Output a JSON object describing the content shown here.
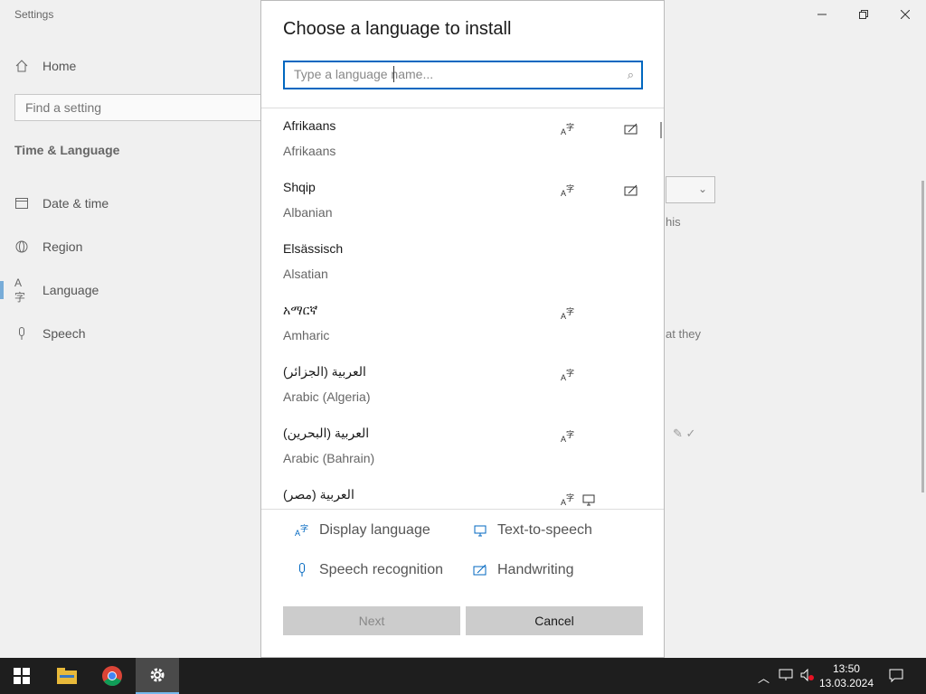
{
  "window": {
    "title": "Settings",
    "minimize_icon": "minimize-icon",
    "restore_icon": "restore-icon",
    "close_icon": "close-icon"
  },
  "sidebar": {
    "home": "Home",
    "find_placeholder": "Find a setting",
    "section": "Time & Language",
    "items": [
      {
        "label": "Date & time",
        "icon": "clock-calendar-icon"
      },
      {
        "label": "Region",
        "icon": "globe-icon"
      },
      {
        "label": "Language",
        "icon": "language-icon",
        "active": true
      },
      {
        "label": "Speech",
        "icon": "microphone-icon"
      }
    ]
  },
  "background_fragments": {
    "frag1": "his",
    "frag2": "at they"
  },
  "dialog": {
    "title": "Choose a language to install",
    "search_placeholder": "Type a language name...",
    "languages": [
      {
        "native": "Afrikaans",
        "english": "Afrikaans",
        "display": true,
        "handwriting": true
      },
      {
        "native": "Shqip",
        "english": "Albanian",
        "display": true,
        "handwriting": true
      },
      {
        "native": "Elsässisch",
        "english": "Alsatian"
      },
      {
        "native": "አማርኛ",
        "english": "Amharic",
        "display": true
      },
      {
        "native": "العربية (الجزائر)",
        "english": "Arabic (Algeria)",
        "display": true
      },
      {
        "native": "العربية (البحرين)",
        "english": "Arabic (Bahrain)",
        "display": true
      },
      {
        "native": "العربية (مصر)",
        "english": "",
        "display": true,
        "tts": true
      }
    ],
    "legend": {
      "display_language": "Display language",
      "text_to_speech": "Text-to-speech",
      "speech_recognition": "Speech recognition",
      "handwriting": "Handwriting"
    },
    "next": "Next",
    "cancel": "Cancel"
  },
  "taskbar": {
    "time": "13:50",
    "date": "13.03.2024"
  },
  "colors": {
    "accent": "#0067c0",
    "taskbar": "#1e1e1e"
  }
}
